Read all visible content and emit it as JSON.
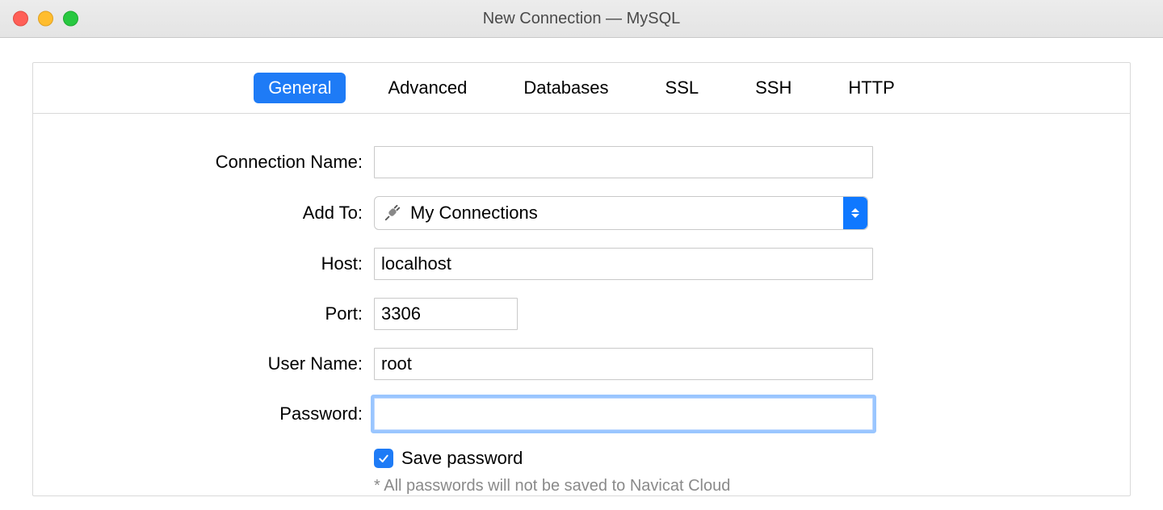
{
  "window": {
    "title": "New Connection — MySQL"
  },
  "tabs": {
    "general": "General",
    "advanced": "Advanced",
    "databases": "Databases",
    "ssl": "SSL",
    "ssh": "SSH",
    "http": "HTTP",
    "active": "general"
  },
  "form": {
    "connection_name": {
      "label": "Connection Name:",
      "value": ""
    },
    "add_to": {
      "label": "Add To:",
      "value": "My Connections"
    },
    "host": {
      "label": "Host:",
      "value": "localhost"
    },
    "port": {
      "label": "Port:",
      "value": "3306"
    },
    "user_name": {
      "label": "User Name:",
      "value": "root"
    },
    "password": {
      "label": "Password:",
      "value": ""
    },
    "save_password": {
      "label": "Save password",
      "checked": true
    },
    "note": "* All passwords will not be saved to Navicat Cloud"
  }
}
